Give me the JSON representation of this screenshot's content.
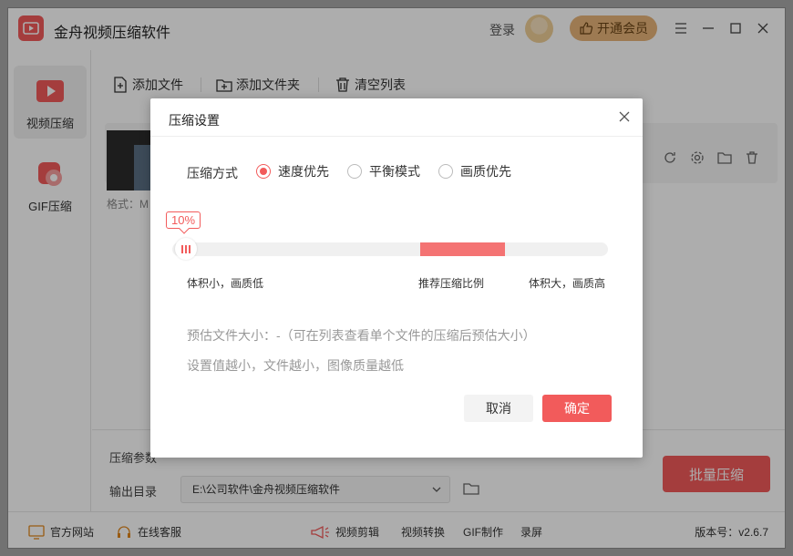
{
  "app": {
    "title": "金舟视频压缩软件",
    "login": "登录",
    "vip": "开通会员"
  },
  "sidebar": {
    "items": [
      {
        "label": "视频压缩",
        "icon": "video-play-icon",
        "active": true
      },
      {
        "label": "GIF压缩",
        "icon": "gif-icon",
        "active": false
      }
    ]
  },
  "toolbar": {
    "add_file": "添加文件",
    "add_folder": "添加文件夹",
    "clear_list": "清空列表"
  },
  "file_card": {
    "format_label": "格式：M"
  },
  "bottom": {
    "param_label": "压缩参数",
    "output_label": "输出目录",
    "output_path": "E:\\公司软件\\金舟视频压缩软件",
    "batch_button": "批量压缩"
  },
  "footer": {
    "website": "官方网站",
    "support": "在线客服",
    "video_edit": "视频剪辑",
    "video_convert": "视频转换",
    "gif_make": "GIF制作",
    "screen_record": "录屏",
    "version": "版本号：v2.6.7"
  },
  "dialog": {
    "title": "压缩设置",
    "mode_label": "压缩方式",
    "modes": [
      {
        "label": "速度优先",
        "selected": true
      },
      {
        "label": "平衡模式",
        "selected": false
      },
      {
        "label": "画质优先",
        "selected": false
      }
    ],
    "percent_label": "10%",
    "slider_value_percent": 10,
    "scale_left": "体积小，画质低",
    "scale_mid": "推荐压缩比例",
    "scale_right": "体积大，画质高",
    "estimate_text": "预估文件大小：-（可在列表查看单个文件的压缩后预估大小）",
    "tip_text": "设置值越小，文件越小，图像质量越低",
    "cancel": "取消",
    "confirm": "确定"
  },
  "colors": {
    "accent": "#f25b5b",
    "vip": "#e7b47a"
  }
}
